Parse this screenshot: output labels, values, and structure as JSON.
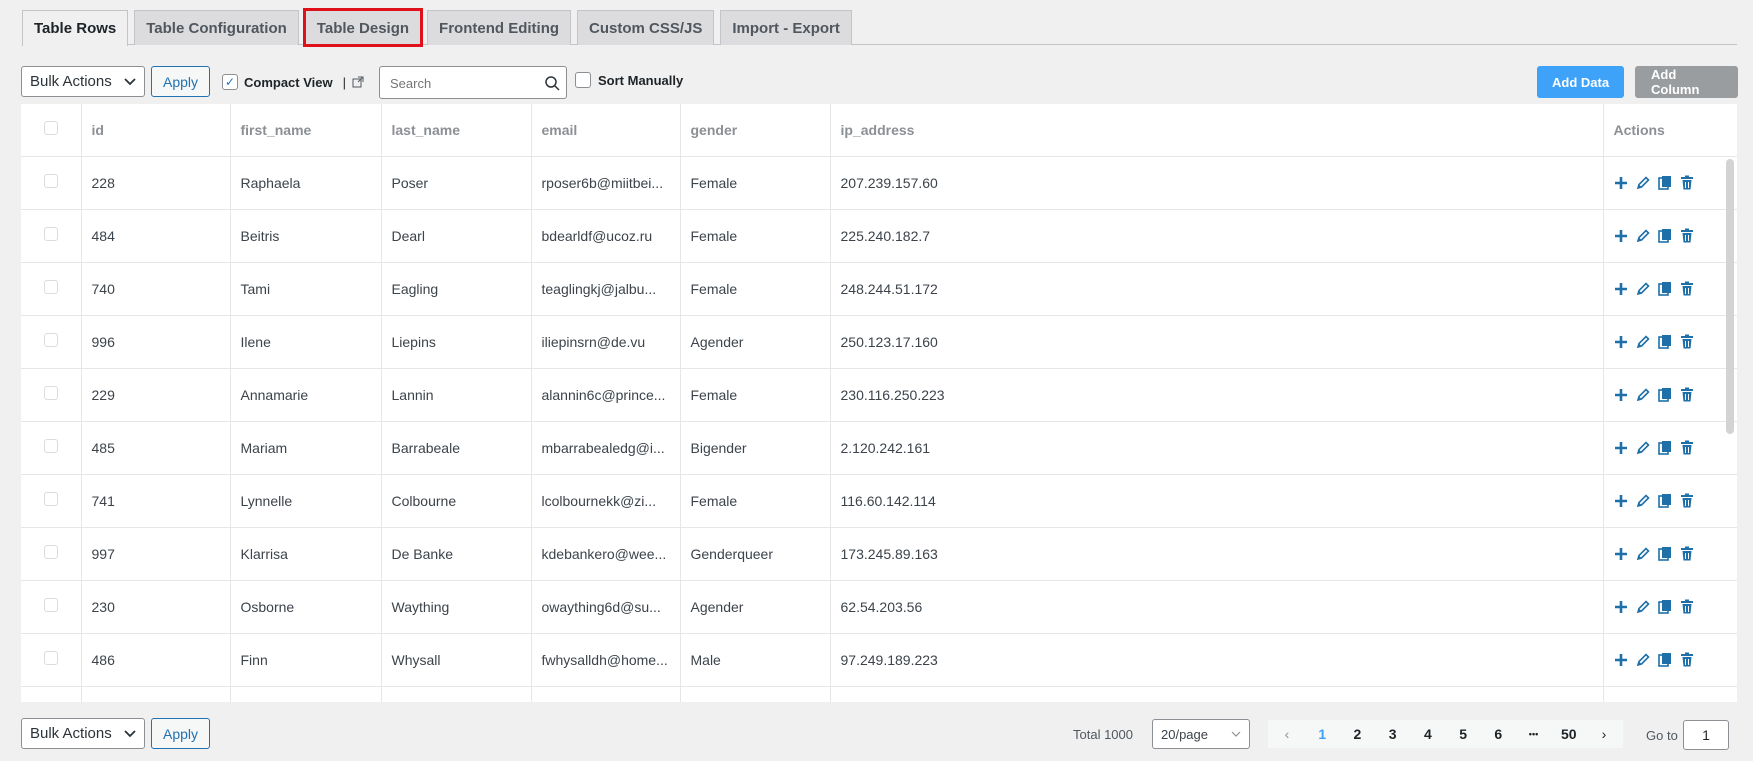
{
  "tabs": [
    {
      "label": "Table Rows"
    },
    {
      "label": "Table Configuration"
    },
    {
      "label": "Table Design"
    },
    {
      "label": "Frontend Editing"
    },
    {
      "label": "Custom CSS/JS"
    },
    {
      "label": "Import - Export"
    }
  ],
  "toolbar": {
    "bulk_actions": "Bulk Actions",
    "apply": "Apply",
    "compact_view": "Compact View",
    "compact_separator": "|",
    "search_placeholder": "Search",
    "sort_manually": "Sort Manually",
    "add_data": "Add Data",
    "add_column": "Add Column"
  },
  "table": {
    "columns": [
      "id",
      "first_name",
      "last_name",
      "email",
      "gender",
      "ip_address",
      "Actions"
    ],
    "rows": [
      {
        "id": "228",
        "first_name": "Raphaela",
        "last_name": "Poser",
        "email": "rposer6b@miitbei...",
        "gender": "Female",
        "ip_address": "207.239.157.60"
      },
      {
        "id": "484",
        "first_name": "Beitris",
        "last_name": "Dearl",
        "email": "bdearldf@ucoz.ru",
        "gender": "Female",
        "ip_address": "225.240.182.7"
      },
      {
        "id": "740",
        "first_name": "Tami",
        "last_name": "Eagling",
        "email": "teaglingkj@jalbu...",
        "gender": "Female",
        "ip_address": "248.244.51.172"
      },
      {
        "id": "996",
        "first_name": "Ilene",
        "last_name": "Liepins",
        "email": "iliepinsrn@de.vu",
        "gender": "Agender",
        "ip_address": "250.123.17.160"
      },
      {
        "id": "229",
        "first_name": "Annamarie",
        "last_name": "Lannin",
        "email": "alannin6c@prince...",
        "gender": "Female",
        "ip_address": "230.116.250.223"
      },
      {
        "id": "485",
        "first_name": "Mariam",
        "last_name": "Barrabeale",
        "email": "mbarrabealedg@i...",
        "gender": "Bigender",
        "ip_address": "2.120.242.161"
      },
      {
        "id": "741",
        "first_name": "Lynnelle",
        "last_name": "Colbourne",
        "email": "lcolbournekk@zi...",
        "gender": "Female",
        "ip_address": "116.60.142.114"
      },
      {
        "id": "997",
        "first_name": "Klarrisa",
        "last_name": "De Banke",
        "email": "kdebankero@wee...",
        "gender": "Genderqueer",
        "ip_address": "173.245.89.163"
      },
      {
        "id": "230",
        "first_name": "Osborne",
        "last_name": "Waything",
        "email": "owaything6d@su...",
        "gender": "Agender",
        "ip_address": "62.54.203.56"
      },
      {
        "id": "486",
        "first_name": "Finn",
        "last_name": "Whysall",
        "email": "fwhysalldh@home...",
        "gender": "Male",
        "ip_address": "97.249.189.223"
      },
      {
        "id": "",
        "first_name": "",
        "last_name": "",
        "email": "",
        "gender": "",
        "ip_address": ""
      }
    ]
  },
  "footer": {
    "bulk_actions": "Bulk Actions",
    "apply": "Apply",
    "total": "Total 1000",
    "page_size": "20/page",
    "pages": [
      "1",
      "2",
      "3",
      "4",
      "5",
      "6",
      "•••",
      "50"
    ],
    "current_page": "1",
    "prev": "‹",
    "next": "›",
    "goto_label": "Go to",
    "goto_value": "1"
  },
  "colors": {
    "accent": "#2271b1",
    "primary_button": "#3ea2f9",
    "highlight": "#e0101b",
    "action_icon": "#1f6fa8"
  },
  "icons": {
    "row_actions": [
      "plus-icon",
      "edit-icon",
      "copy-icon",
      "trash-icon"
    ],
    "search": "search-icon",
    "external": "external-link-icon"
  }
}
